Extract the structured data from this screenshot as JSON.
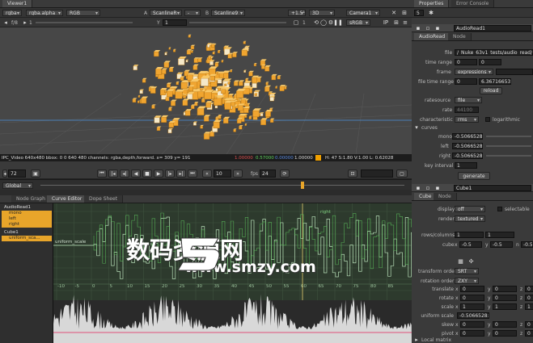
{
  "viewer": {
    "tab": "Viewer1",
    "row1": {
      "channels": "rgba",
      "layer": "rgba.alpha",
      "mode": "RGB",
      "a_label": "A",
      "a_input": "ScanlineR",
      "a_op": "-",
      "b_label": "B",
      "b_input": "Scanline9",
      "zoom": "+1.5¹",
      "view": "3D",
      "camera": "Camera1"
    },
    "row2": {
      "fstop": "f/8",
      "frame": "1",
      "y_label": "Y",
      "y_value": "1",
      "lut": "sRGB"
    },
    "status": {
      "text": "IPC_Video 640x480 bbox: 0 0 640 480 channels: rgba,depth,forward. x= 309 y= 191",
      "r": "1.00000",
      "g": "0.57000",
      "b": "0.00000",
      "a": "1.00000",
      "extra": "H: 47 S:1.80 V:1.00 L: 0.62028"
    },
    "timeline": {
      "frame": "10",
      "fps_label": "fps",
      "fps": "24",
      "frame_field": "72",
      "scope": "Global"
    }
  },
  "graph_panel": {
    "tabs": [
      "Node Graph",
      "Curve Editor",
      "Dope Sheet"
    ],
    "tree": [
      {
        "label": "AudioRead1",
        "level": 0
      },
      {
        "label": "mono",
        "level": 1
      },
      {
        "label": "left",
        "level": 1
      },
      {
        "label": "right",
        "level": 1
      },
      {
        "label": "Cube1",
        "level": 0
      },
      {
        "label": "uniform_sca...",
        "level": 1
      }
    ],
    "curve_labels": {
      "left_label": "uniform_scale",
      "right_label": "right"
    },
    "x_ticks": [
      "-10",
      "-5",
      "0",
      "5",
      "10",
      "15",
      "20",
      "25",
      "30",
      "35",
      "40",
      "45",
      "50",
      "55",
      "60",
      "65",
      "70",
      "75",
      "80",
      "85"
    ],
    "watermark": {
      "title": "数码资源网",
      "url": "www.smzy.com"
    }
  },
  "properties": {
    "tabs": [
      "Properties",
      "Error Console"
    ],
    "count": "5",
    "audio_node": {
      "name": "AudioRead1",
      "tabs": [
        "AudioRead",
        "Node"
      ],
      "file_label": "file",
      "file": "/_Nuke_63v1_tests/audio_read/a",
      "time_range_label": "time range",
      "time_range": [
        "0",
        "0"
      ],
      "frame_label": "frame",
      "frame": "expressions",
      "file_time_range_label": "file time range",
      "file_time_range": [
        "0",
        "6.36716653"
      ],
      "reload": "reload",
      "ratesource_label": "ratesource",
      "ratesource": "file",
      "rate_label": "rate",
      "rate": "44100",
      "characteristic_label": "characteristic",
      "characteristic": "rms",
      "logarithmic": "logarithmic",
      "curves": "curves",
      "mono_label": "mono",
      "mono": "-0.5066528:",
      "left_label": "left",
      "left": "-0.5066528:",
      "right_label": "right",
      "right": "-0.5066528:",
      "key_interval_label": "key interval",
      "key_interval": "1",
      "generate": "generate"
    },
    "cube_node": {
      "name": "Cube1",
      "tabs": [
        "Cube",
        "Node"
      ],
      "display_label": "display",
      "display": "off",
      "selectable": "selectable",
      "render_label": "render",
      "render": "textured",
      "rows_label": "rows/columns",
      "rows": "1",
      "columns": "1",
      "cube_label": "cube",
      "cube_x": "-0.5",
      "cube_y": "-0.5",
      "cube_n": "-0.5",
      "transform_order_label": "transform order",
      "transform_order": "SRT",
      "rotation_order_label": "rotation order",
      "rotation_order": "ZXY",
      "translate_label": "translate",
      "rotate_label": "rotate",
      "scale_label": "scale",
      "uniform_scale_label": "uniform scale",
      "uniform_scale": "-0.5066528:",
      "skew_label": "skew",
      "pivot_label": "pivot",
      "zero": "0",
      "one": "1",
      "x": "x",
      "y": "y",
      "z": "z",
      "local_matrix": "Local matrix"
    }
  },
  "colors": {
    "accent_orange": "#e8a52a",
    "panel": "#3a3a3a",
    "dark": "#1e1e1e"
  }
}
